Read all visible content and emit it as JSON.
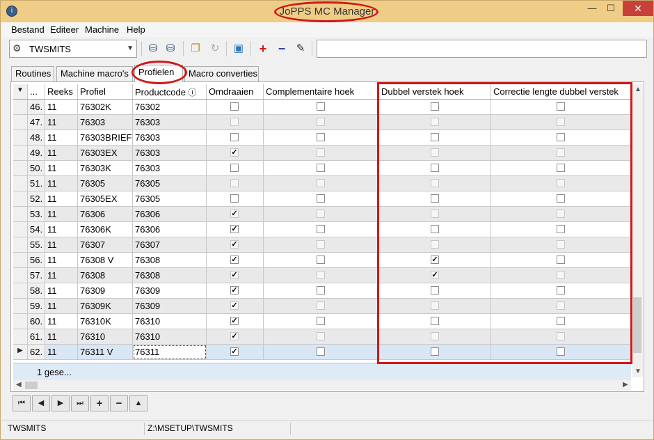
{
  "window": {
    "title": "JoPPS MC Manager",
    "controls": {
      "minimize": "—",
      "maximize": "☐",
      "close": "✕"
    }
  },
  "menu": [
    "Bestand",
    "Editeer",
    "Machine",
    "Help"
  ],
  "toolbar": {
    "machine_select": "TWSMITS",
    "icons": [
      "database-import-icon",
      "database-export-icon",
      "copy-icon",
      "redo-icon",
      "package-icon",
      "add-icon",
      "remove-icon",
      "edit-icon"
    ],
    "text_value": ""
  },
  "tabs": [
    "Routines",
    "Machine macro's",
    "Profielen",
    "Macro converties"
  ],
  "active_tab": "Profielen",
  "grid": {
    "headers": [
      "...",
      "Reeks",
      "Profiel",
      "Productcode",
      "Omdraaien",
      "Complementaire hoek",
      "Dubbel verstek hoek",
      "Correctie lengte dubbel verstek"
    ],
    "rows": [
      {
        "n": "46.",
        "reeks": "11",
        "profiel": "76302K",
        "code": "76302",
        "omdraaien": false,
        "compl": false,
        "dubbel": false,
        "correctie": false
      },
      {
        "n": "47.",
        "reeks": "11",
        "profiel": "76303",
        "code": "76303",
        "omdraaien": false,
        "compl": false,
        "dubbel": false,
        "correctie": false
      },
      {
        "n": "48.",
        "reeks": "11",
        "profiel": "76303BRIEF",
        "code": "76303",
        "omdraaien": false,
        "compl": false,
        "dubbel": false,
        "correctie": false
      },
      {
        "n": "49.",
        "reeks": "11",
        "profiel": "76303EX",
        "code": "76303",
        "omdraaien": true,
        "compl": false,
        "dubbel": false,
        "correctie": false
      },
      {
        "n": "50.",
        "reeks": "11",
        "profiel": "76303K",
        "code": "76303",
        "omdraaien": false,
        "compl": false,
        "dubbel": false,
        "correctie": false
      },
      {
        "n": "51.",
        "reeks": "11",
        "profiel": "76305",
        "code": "76305",
        "omdraaien": false,
        "compl": false,
        "dubbel": false,
        "correctie": false
      },
      {
        "n": "52.",
        "reeks": "11",
        "profiel": "76305EX",
        "code": "76305",
        "omdraaien": false,
        "compl": false,
        "dubbel": false,
        "correctie": false
      },
      {
        "n": "53.",
        "reeks": "11",
        "profiel": "76306",
        "code": "76306",
        "omdraaien": true,
        "compl": false,
        "dubbel": false,
        "correctie": false
      },
      {
        "n": "54.",
        "reeks": "11",
        "profiel": "76306K",
        "code": "76306",
        "omdraaien": true,
        "compl": false,
        "dubbel": false,
        "correctie": false
      },
      {
        "n": "55.",
        "reeks": "11",
        "profiel": "76307",
        "code": "76307",
        "omdraaien": true,
        "compl": false,
        "dubbel": false,
        "correctie": false
      },
      {
        "n": "56.",
        "reeks": "11",
        "profiel": "76308 V",
        "code": "76308",
        "omdraaien": true,
        "compl": false,
        "dubbel": true,
        "correctie": false
      },
      {
        "n": "57.",
        "reeks": "11",
        "profiel": "76308",
        "code": "76308",
        "omdraaien": true,
        "compl": false,
        "dubbel": true,
        "correctie": false
      },
      {
        "n": "58.",
        "reeks": "11",
        "profiel": "76309",
        "code": "76309",
        "omdraaien": true,
        "compl": false,
        "dubbel": false,
        "correctie": false
      },
      {
        "n": "59.",
        "reeks": "11",
        "profiel": "76309K",
        "code": "76309",
        "omdraaien": true,
        "compl": false,
        "dubbel": false,
        "correctie": false
      },
      {
        "n": "60.",
        "reeks": "11",
        "profiel": "76310K",
        "code": "76310",
        "omdraaien": true,
        "compl": false,
        "dubbel": false,
        "correctie": false
      },
      {
        "n": "61.",
        "reeks": "11",
        "profiel": "76310",
        "code": "76310",
        "omdraaien": true,
        "compl": false,
        "dubbel": false,
        "correctie": false
      },
      {
        "n": "62.",
        "reeks": "11",
        "profiel": "76311 V",
        "code": "76311",
        "omdraaien": true,
        "compl": false,
        "dubbel": false,
        "correctie": false
      }
    ],
    "current_row": "62.",
    "footer_text": "1 gese..."
  },
  "navigator": [
    "first-record-icon",
    "prior-record-icon",
    "next-record-icon",
    "last-record-icon",
    "insert-record-icon",
    "delete-record-icon",
    "post-record-icon"
  ],
  "status": {
    "machine": "TWSMITS",
    "path": "Z:\\MSETUP\\TWSMITS"
  }
}
